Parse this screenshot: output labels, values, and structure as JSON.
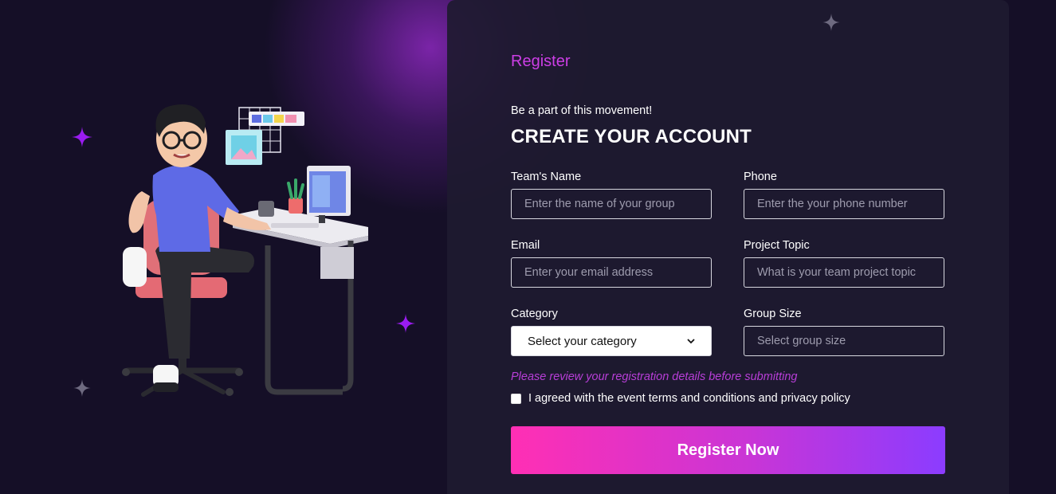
{
  "form": {
    "title": "Register",
    "subtitle": "Be a part of this movement!",
    "headline": "CREATE YOUR ACCOUNT",
    "fields": {
      "team_name": {
        "label": "Team's Name",
        "placeholder": "Enter the name of your group"
      },
      "phone": {
        "label": "Phone",
        "placeholder": "Enter the your phone number"
      },
      "email": {
        "label": "Email",
        "placeholder": "Enter your email address"
      },
      "project_topic": {
        "label": "Project Topic",
        "placeholder": "What is your team project topic"
      },
      "category": {
        "label": "Category",
        "selected": "Select your category"
      },
      "group_size": {
        "label": "Group Size",
        "placeholder": "Select group size"
      }
    },
    "review_note": "Please review your registration details before submitting",
    "terms_label": "I agreed with the event terms and conditions and privacy policy",
    "submit_label": "Register Now"
  },
  "colors": {
    "background": "#150f27",
    "panel": "#1e1a30",
    "accent": "#cd3ee6",
    "button_start": "#ff2fb4",
    "button_end": "#8b3cff"
  },
  "icons": [
    "sparkle-icon",
    "chevron-down-icon",
    "developer-at-desk-illustration"
  ]
}
